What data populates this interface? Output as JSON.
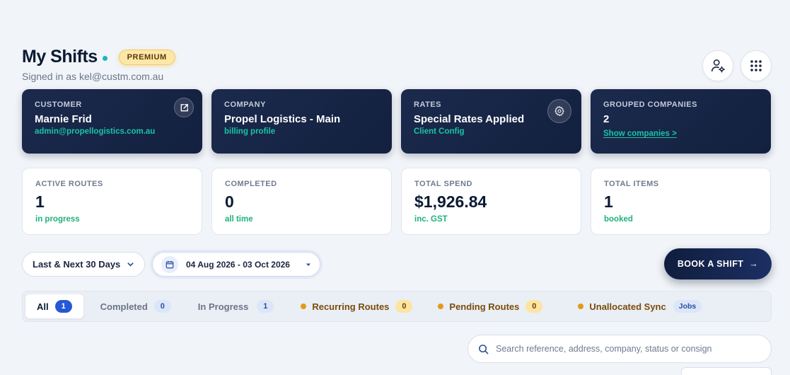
{
  "header": {
    "title": "My Shifts",
    "badge": "PREMIUM",
    "signed_in": "Signed in as kel@custm.com.au"
  },
  "header_actions": {
    "profile_icon": "user-settings-icon",
    "apps_icon": "grid-icon"
  },
  "info_cards": [
    {
      "label": "CUSTOMER",
      "value": "Marnie Frid",
      "sub": "admin@propellogistics.com.au",
      "icon": "external-link-icon"
    },
    {
      "label": "COMPANY",
      "value": "Propel Logistics - Main",
      "sub": "billing profile"
    },
    {
      "label": "RATES",
      "value": "Special Rates Applied",
      "sub": "Client Config",
      "icon": "gear-icon"
    },
    {
      "label": "GROUPED COMPANIES",
      "value": "2",
      "link": "Show companies >"
    }
  ],
  "stats": [
    {
      "label": "ACTIVE ROUTES",
      "value": "1",
      "sub": "in progress"
    },
    {
      "label": "COMPLETED",
      "value": "0",
      "sub": "all time"
    },
    {
      "label": "TOTAL SPEND",
      "value": "$1,926.84",
      "sub": "inc. GST"
    },
    {
      "label": "TOTAL ITEMS",
      "value": "1",
      "sub": "booked"
    }
  ],
  "filters": {
    "range": "Last & Next 30 Days",
    "date_range": "04 Aug 2026 - 03 Oct 2026",
    "book_button": "BOOK A SHIFT",
    "book_arrow": "→"
  },
  "tabs": [
    {
      "label": "All",
      "count": "1"
    },
    {
      "label": "Completed",
      "count": "0"
    },
    {
      "label": "In Progress",
      "count": "1"
    },
    {
      "label": "Recurring Routes",
      "count": "0"
    },
    {
      "label": "Pending Routes",
      "count": "0"
    },
    {
      "label": "Unallocated Sync",
      "tag": "Jobs"
    }
  ],
  "search": {
    "placeholder": "Search reference, address, company, status or consign"
  },
  "colors": {
    "accent": "#19c4a8",
    "navy": "#13203f",
    "active_tab_count": "#2458d6",
    "warning_dot": "#e19a19"
  }
}
